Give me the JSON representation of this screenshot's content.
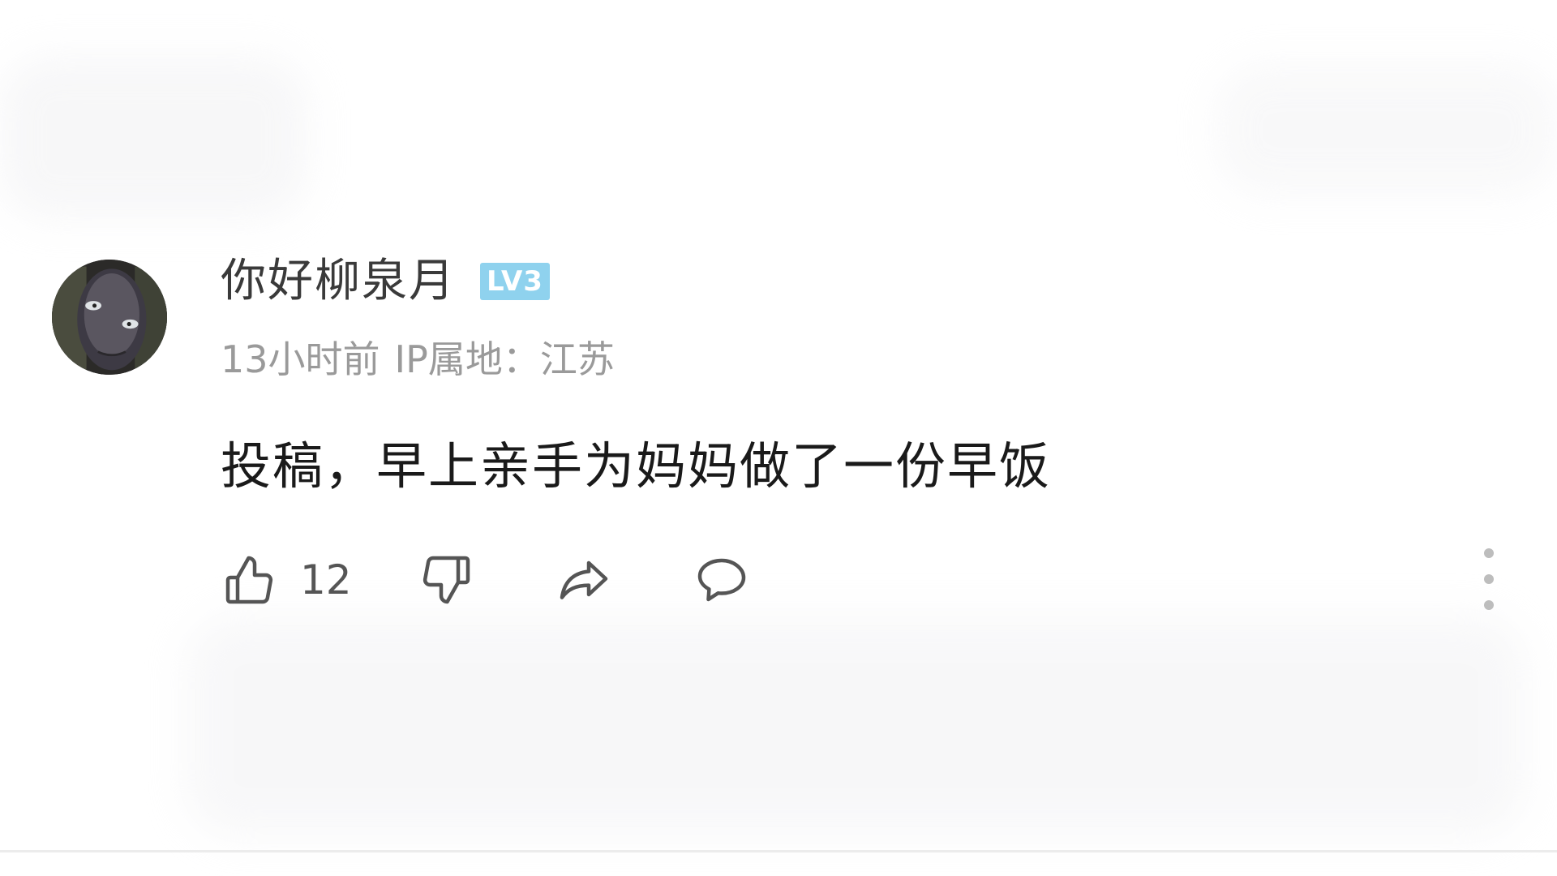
{
  "comment": {
    "username": "你好柳泉月",
    "level_badge": "LV3",
    "time": "13小时前",
    "ip_location": "IP属地：江苏",
    "text": "投稿，早上亲手为妈妈做了一份早饭",
    "actions": {
      "like_count": "12",
      "like_icon": "thumbs-up-icon",
      "dislike_icon": "thumbs-down-icon",
      "share_icon": "share-icon",
      "reply_icon": "comment-bubble-icon",
      "more_icon": "more-vertical-icon"
    }
  },
  "colors": {
    "level_badge": "#8fd2ee",
    "username": "#3a3a3a",
    "meta": "#9a9a9a",
    "text": "#1a1a1a",
    "icon": "#555555"
  }
}
